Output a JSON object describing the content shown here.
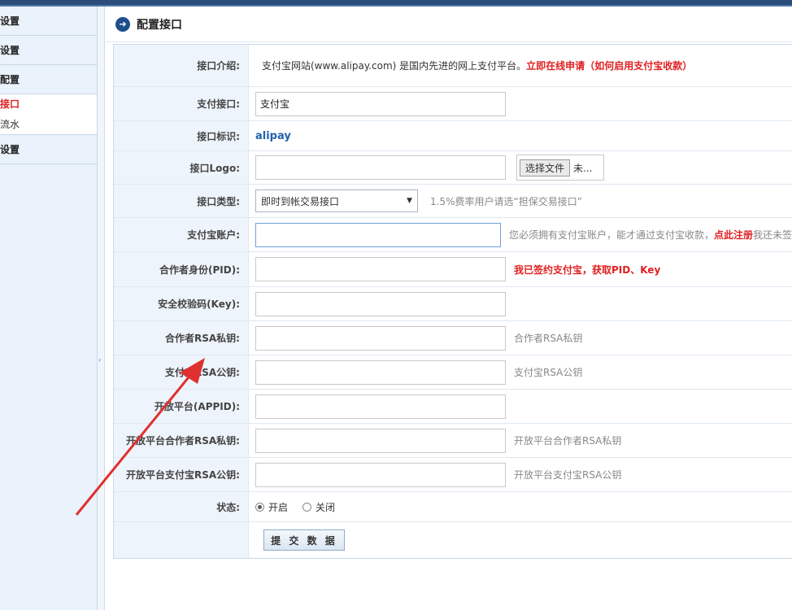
{
  "sidebar": {
    "items": [
      {
        "label": "设置"
      },
      {
        "label": "设置"
      },
      {
        "label": "配置"
      }
    ],
    "sub_items": [
      {
        "label": "接口"
      },
      {
        "label": "流水"
      }
    ],
    "last_item": {
      "label": "设置"
    },
    "collapse_glyph": "‹"
  },
  "header": {
    "icon": "arrow-right-circle-icon",
    "title": "配置接口"
  },
  "form": {
    "intro_label": "接口介绍:",
    "intro_text": "支付宝网站(www.alipay.com) 是国内先进的网上支付平台。",
    "intro_link1": "立即在线申请",
    "intro_link2": "（如何启用支付宝收款）",
    "name_label": "支付接口:",
    "name_value": "支付宝",
    "id_label": "接口标识:",
    "id_value": "alipay",
    "logo_label": "接口Logo:",
    "file_button": "选择文件",
    "file_status": "未...",
    "type_label": "接口类型:",
    "type_value": "即时到帐交易接口",
    "type_arrow": "▼",
    "type_hint": "1.5%费率用户请选“担保交易接口”",
    "account_label": "支付宝账户:",
    "account_hint": "您必须拥有支付宝账户，能才通过支付宝收款，",
    "account_link": "点此注册",
    "account_hint2": "我还未签",
    "pid_label": "合作者身份(PID):",
    "pid_link": "我已签约支付宝，获取PID、Key",
    "key_label": "安全校验码(Key):",
    "rsa_private_label": "合作者RSA私钥:",
    "rsa_private_hint": "合作者RSA私钥",
    "rsa_public_label": "支付宝RSA公钥:",
    "rsa_public_hint": "支付宝RSA公钥",
    "appid_label": "开放平台(APPID):",
    "open_private_label": "开放平台合作者RSA私钥:",
    "open_private_hint": "开放平台合作者RSA私钥",
    "open_public_label": "开放平台支付宝RSA公钥:",
    "open_public_hint": "开放平台支付宝RSA公钥",
    "status_label": "状态:",
    "status_on": "开启",
    "status_off": "关闭",
    "submit_label": "提 交 数 据"
  },
  "colors": {
    "accent": "#1e4f8c",
    "link_red": "#e02020",
    "annotation_arrow": "#e03030"
  }
}
